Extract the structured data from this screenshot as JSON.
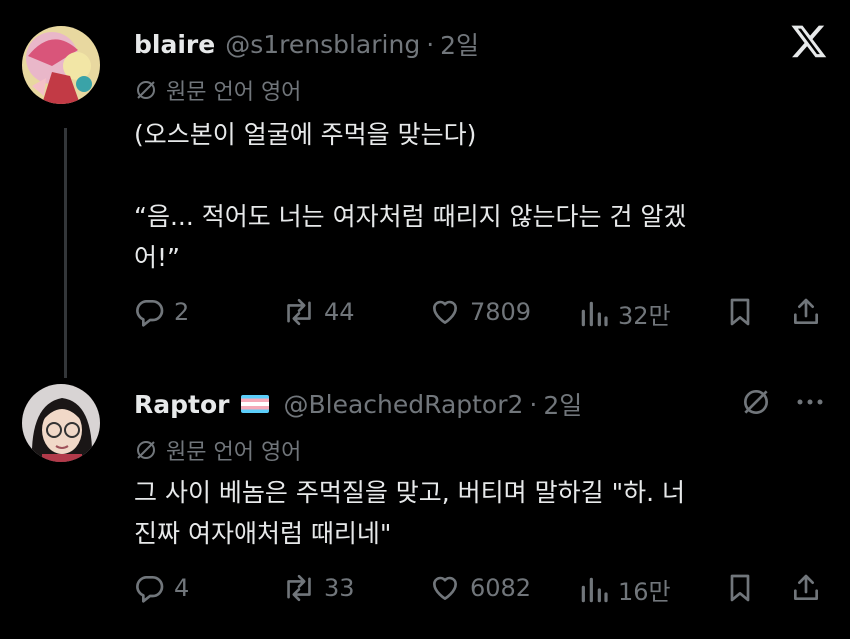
{
  "tweet1": {
    "name": "blaire",
    "handle": "@s1rensblaring",
    "sep": "·",
    "time": "2일",
    "translate_label": "원문 언어 영어",
    "body": "(오스본이 얼굴에 주먹을 맞는다)\n\n“음... 적어도 너는 여자처럼 때리지 않는다는 건 알겠\n어!”",
    "replies": "2",
    "reposts": "44",
    "likes": "7809",
    "views": "32만"
  },
  "tweet2": {
    "name": "Raptor",
    "handle": "@BleachedRaptor2",
    "sep": "·",
    "time": "2일",
    "translate_label": "원문 언어 영어",
    "body": "그 사이 베놈은 주먹질을 맞고, 버티며 말하길 \"하. 너\n진짜 여자애처럼 때리네\"",
    "replies": "4",
    "reposts": "33",
    "likes": "6082",
    "views": "16만"
  },
  "icons": {
    "logo": "x-logo-icon",
    "translate": "translate-icon",
    "reply": "reply-icon",
    "repost": "repost-icon",
    "like": "heart-icon",
    "views": "views-icon",
    "bookmark": "bookmark-icon",
    "share": "share-icon",
    "more": "more-icon"
  },
  "colors": {
    "background": "#000000",
    "text": "#e7e9ea",
    "muted": "#71767b"
  }
}
